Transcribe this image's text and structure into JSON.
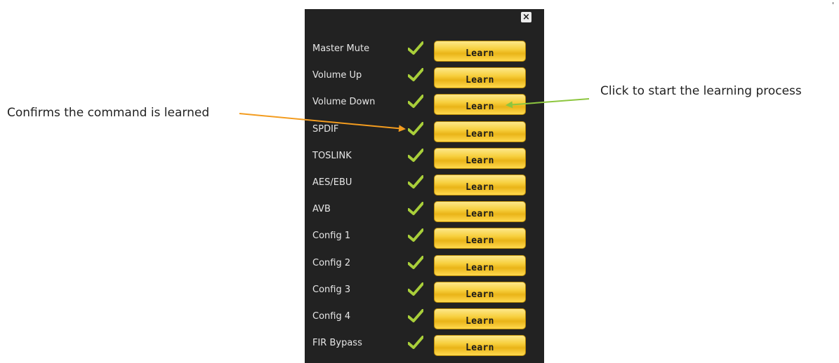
{
  "dialog": {
    "close_symbol": "×",
    "learn_label": "Learn",
    "items": [
      {
        "label": "Master Mute",
        "learned": true
      },
      {
        "label": "Volume Up",
        "learned": true
      },
      {
        "label": "Volume Down",
        "learned": true
      },
      {
        "label": "SPDIF",
        "learned": true
      },
      {
        "label": "TOSLINK",
        "learned": true
      },
      {
        "label": "AES/EBU",
        "learned": true
      },
      {
        "label": "AVB",
        "learned": true
      },
      {
        "label": "Config 1",
        "learned": true
      },
      {
        "label": "Config 2",
        "learned": true
      },
      {
        "label": "Config 3",
        "learned": true
      },
      {
        "label": "Config 4",
        "learned": true
      },
      {
        "label": "FIR Bypass",
        "learned": true
      }
    ]
  },
  "annotations": {
    "left": "Confirms the command is learned",
    "right": "Click to start the learning process"
  },
  "colors": {
    "panel": "#222222",
    "checkmark": "#a9cf3a",
    "button": "#f7cf3d",
    "arrow_left": "#f39c1f",
    "arrow_right": "#8dc63f"
  }
}
